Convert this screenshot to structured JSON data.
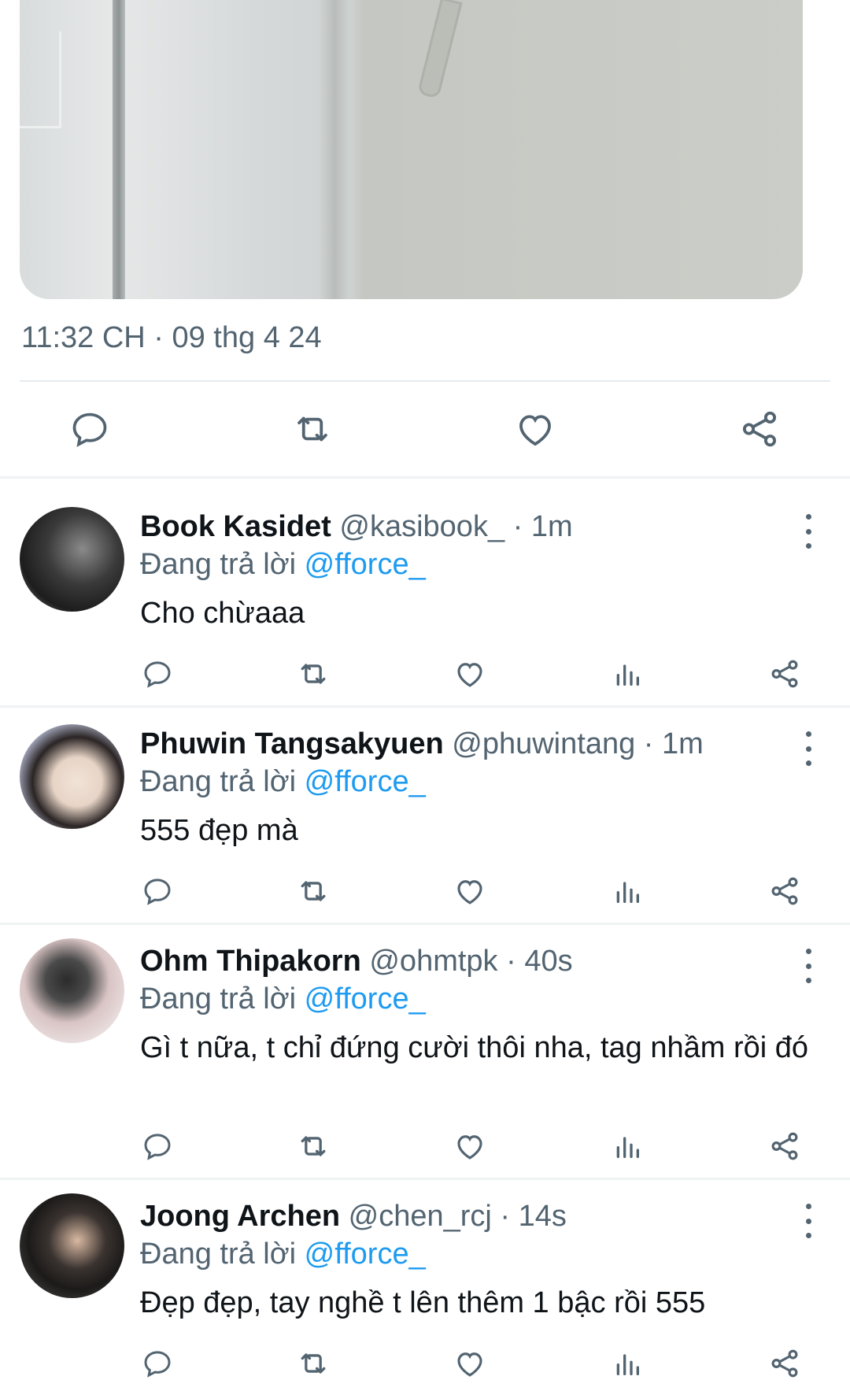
{
  "tweet": {
    "timestamp": "11:32 CH · 09 thg 4 24"
  },
  "replies": [
    {
      "name": "Book Kasidet",
      "handle_meta": " @kasibook_ · 1m",
      "replying_prefix": "Đang trả lời ",
      "mention": "@fforce_",
      "text": "Cho chừaaa"
    },
    {
      "name": "Phuwin Tangsakyuen",
      "handle_meta": " @phuwintang · 1m",
      "replying_prefix": "Đang trả lời ",
      "mention": "@fforce_",
      "text": "555 đẹp mà"
    },
    {
      "name": "Ohm Thipakorn",
      "handle_meta": " @ohmtpk · 40s",
      "replying_prefix": "Đang trả lời ",
      "mention": "@fforce_",
      "text": "Gì t nữa, t chỉ đứng cười thôi nha, tag nhầm rồi đó"
    },
    {
      "name": "Joong Archen",
      "handle_meta": " @chen_rcj · 14s",
      "replying_prefix": "Đang trả lời ",
      "mention": "@fforce_",
      "text": "Đẹp đẹp, tay nghề t lên thêm 1 bậc rồi 555"
    }
  ],
  "icons": {
    "reply": "reply-icon",
    "retweet": "retweet-icon",
    "like": "heart-icon",
    "views": "analytics-icon",
    "share": "share-icon",
    "more": "more-vertical-icon"
  },
  "colors": {
    "text": "#0f1419",
    "secondary": "#536471",
    "link": "#1d9bf0",
    "divider": "#eff3f4"
  }
}
